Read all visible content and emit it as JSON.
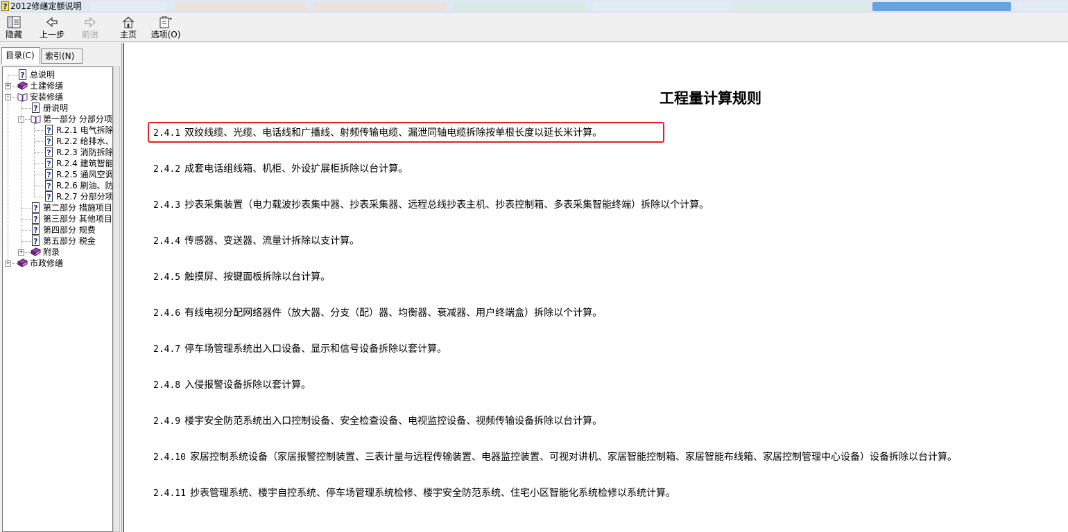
{
  "window": {
    "title": "2012修缮定额说明"
  },
  "toolbar": {
    "hide": "隐藏",
    "back": "上一步",
    "forward": "前进",
    "home": "主页",
    "options": "选项(O)"
  },
  "pane_tabs": {
    "contents": "目录(C)",
    "index": "索引(N)"
  },
  "tree": [
    {
      "label": "总说明",
      "icon": "help-page-icon"
    },
    {
      "label": "土建修缮",
      "icon": "closed-book-icon"
    },
    {
      "label": "安装修缮",
      "icon": "open-book-icon"
    },
    {
      "label": "册说明",
      "icon": "help-page-icon"
    },
    {
      "label": "第一部分 分部分项",
      "icon": "open-book-icon"
    },
    {
      "label": "R.2.1 电气拆除",
      "icon": "help-page-icon"
    },
    {
      "label": "R.2.2 给排水、",
      "icon": "help-page-icon"
    },
    {
      "label": "R.2.3 消防拆除",
      "icon": "help-page-icon"
    },
    {
      "label": "R.2.4 建筑智能",
      "icon": "help-page-icon"
    },
    {
      "label": "R.2.5 通风空调",
      "icon": "help-page-icon"
    },
    {
      "label": "R.2.6 刷油、防",
      "icon": "help-page-icon"
    },
    {
      "label": "R.2.7 分部分项",
      "icon": "help-page-icon"
    },
    {
      "label": "第二部分 措施项目",
      "icon": "help-page-icon"
    },
    {
      "label": "第三部分 其他项目",
      "icon": "help-page-icon"
    },
    {
      "label": "第四部分 规费",
      "icon": "help-page-icon"
    },
    {
      "label": "第五部分 税金",
      "icon": "help-page-icon"
    },
    {
      "label": "附录",
      "icon": "closed-book-icon"
    },
    {
      "label": "市政修缮",
      "icon": "closed-book-icon"
    }
  ],
  "document": {
    "title": "工程量计算规则",
    "rules": [
      {
        "num": "2.4.1",
        "text": "双绞线缆、光缆、电话线和广播线、射频传输电缆、漏泄同轴电缆拆除按单根长度以延长米计算。"
      },
      {
        "num": "2.4.2",
        "text": "成套电话组线箱、机柜、外设扩展柜拆除以台计算。"
      },
      {
        "num": "2.4.3",
        "text": "抄表采集装置（电力载波抄表集中器、抄表采集器、远程总线抄表主机、抄表控制箱、多表采集智能终端）拆除以个计算。"
      },
      {
        "num": "2.4.4",
        "text": "传感器、变送器、流量计拆除以支计算。"
      },
      {
        "num": "2.4.5",
        "text": "触摸屏、按键面板拆除以台计算。"
      },
      {
        "num": "2.4.6",
        "text": "有线电视分配网络器件（放大器、分支（配）器、均衡器、衰减器、用户终端盒）拆除以个计算。"
      },
      {
        "num": "2.4.7",
        "text": "停车场管理系统出入口设备、显示和信号设备拆除以套计算。"
      },
      {
        "num": "2.4.8",
        "text": "入侵报警设备拆除以套计算。"
      },
      {
        "num": "2.4.9",
        "text": "楼宇安全防范系统出入口控制设备、安全检查设备、电视监控设备、视频传输设备拆除以台计算。"
      },
      {
        "num": "2.4.10",
        "text": "家居控制系统设备（家居报警控制装置、三表计量与远程传输装置、电器监控装置、可视对讲机、家居智能控制箱、家居智能布线箱、家居控制管理中心设备）设备拆除以台计算。"
      },
      {
        "num": "2.4.11",
        "text": "抄表管理系统、楼宇自控系统、停车场管理系统检修、楼宇安全防范系统、住宅小区智能化系统检修以系统计算。"
      }
    ]
  },
  "colors": {
    "highlight": "#e21e1e",
    "titlebar": "#dfe8f3",
    "toolbar": "#f0f0f0"
  }
}
